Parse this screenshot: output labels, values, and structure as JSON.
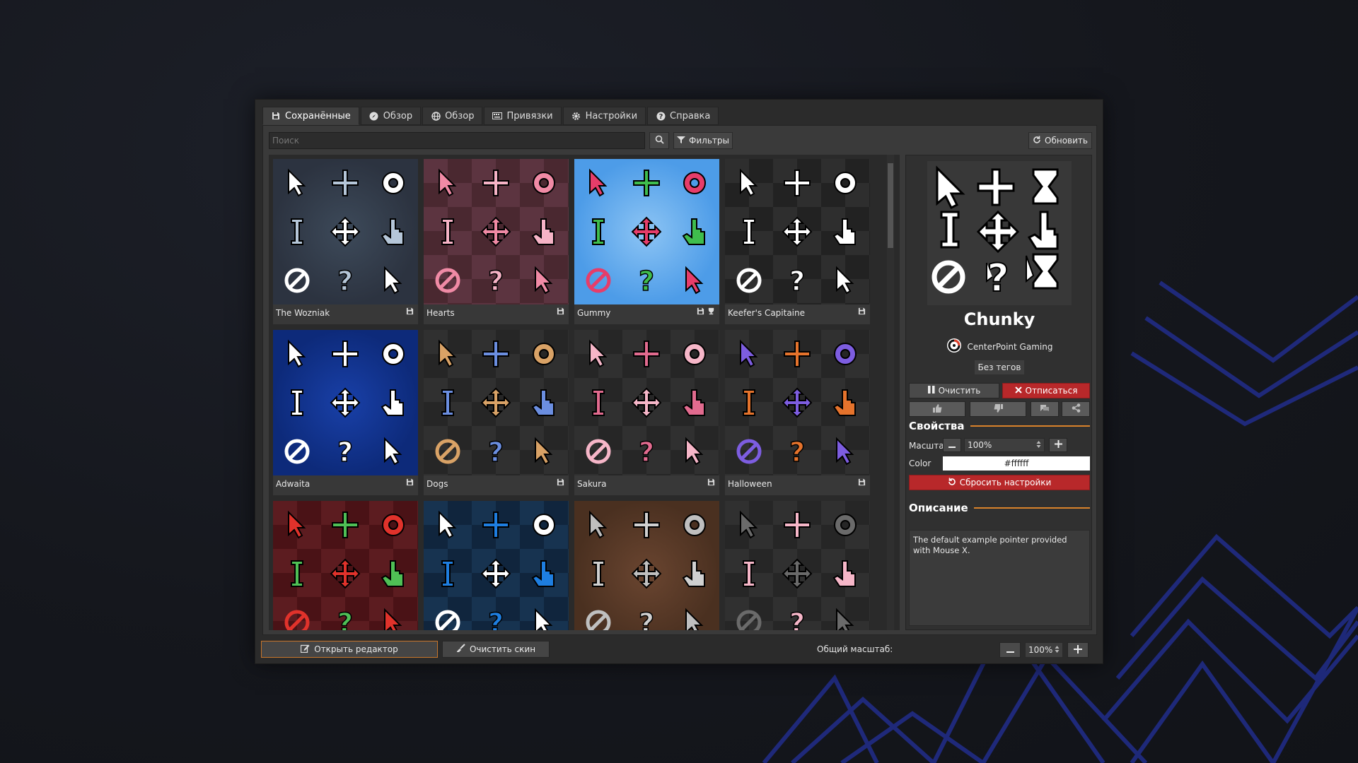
{
  "tabs": [
    {
      "label": "Сохранённые",
      "icon": "save-icon",
      "active": true
    },
    {
      "label": "Обзор",
      "icon": "compass-icon"
    },
    {
      "label": "Обзор",
      "icon": "globe-icon"
    },
    {
      "label": "Привязки",
      "icon": "keyboard-icon"
    },
    {
      "label": "Настройки",
      "icon": "gear-icon"
    },
    {
      "label": "Справка",
      "icon": "help-icon"
    }
  ],
  "toolbar": {
    "search_placeholder": "Поиск",
    "filters_label": "Фильтры",
    "refresh_label": "Обновить"
  },
  "skins": [
    {
      "name": "The Wozniak",
      "theme": "galaxy",
      "trophy": false
    },
    {
      "name": "Hearts",
      "theme": "hearts",
      "trophy": false
    },
    {
      "name": "Gummy",
      "theme": "gummy",
      "trophy": true
    },
    {
      "name": "Keefer's Capitaine",
      "theme": "capitaine",
      "trophy": false
    },
    {
      "name": "Adwaita",
      "theme": "adwaita",
      "trophy": false
    },
    {
      "name": "Dogs",
      "theme": "dogs",
      "trophy": false
    },
    {
      "name": "Sakura",
      "theme": "sakura",
      "trophy": false
    },
    {
      "name": "Halloween",
      "theme": "halloween",
      "trophy": false
    },
    {
      "name": "",
      "theme": "fruits"
    },
    {
      "name": "",
      "theme": "bluegrid"
    },
    {
      "name": "",
      "theme": "medieval"
    },
    {
      "name": "",
      "theme": "cats"
    }
  ],
  "details": {
    "title": "Chunky",
    "author": "CenterPoint Gaming",
    "tags": "Без тегов",
    "clear_label": "Очистить",
    "unsubscribe_label": "Отписаться",
    "properties_header": "Свойства",
    "scale_label": "Масштаб",
    "scale_value": "100%",
    "color_label": "Color",
    "color_value": "#ffffff",
    "reset_label": "Сбросить настройки",
    "description_header": "Описание",
    "description": "The default example pointer provided with Mouse X."
  },
  "footer": {
    "open_editor_label": "Открыть редактор",
    "clear_skin_label": "Очистить скин",
    "global_scale_label": "Общий масштаб:",
    "global_scale_value": "100%"
  },
  "colors": {
    "accent_orange": "#d9822b",
    "danger_red": "#b8282a",
    "background": "#15171d",
    "line_blue": "#2a35a8"
  }
}
